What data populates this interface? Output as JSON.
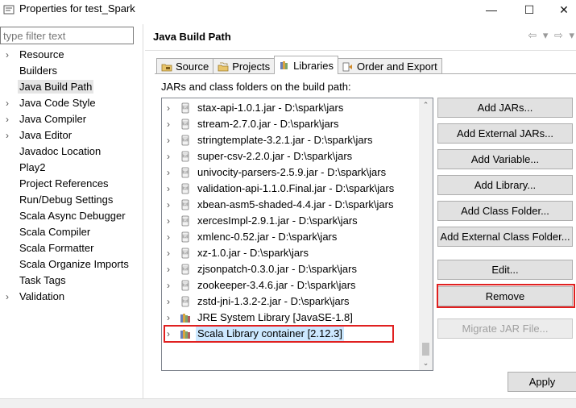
{
  "window": {
    "title": "Properties for test_Spark",
    "minimize_glyph": "—",
    "maximize_glyph": "☐",
    "close_glyph": "✕"
  },
  "filter": {
    "placeholder": "type filter text",
    "value": ""
  },
  "nav": {
    "items": [
      {
        "label": "Resource",
        "expandable": true
      },
      {
        "label": "Builders",
        "expandable": false
      },
      {
        "label": "Java Build Path",
        "expandable": false,
        "selected": true
      },
      {
        "label": "Java Code Style",
        "expandable": true
      },
      {
        "label": "Java Compiler",
        "expandable": true
      },
      {
        "label": "Java Editor",
        "expandable": true
      },
      {
        "label": "Javadoc Location",
        "expandable": false
      },
      {
        "label": "Play2",
        "expandable": false
      },
      {
        "label": "Project References",
        "expandable": false
      },
      {
        "label": "Run/Debug Settings",
        "expandable": false
      },
      {
        "label": "Scala Async Debugger",
        "expandable": false
      },
      {
        "label": "Scala Compiler",
        "expandable": false
      },
      {
        "label": "Scala Formatter",
        "expandable": false
      },
      {
        "label": "Scala Organize Imports",
        "expandable": false
      },
      {
        "label": "Task Tags",
        "expandable": false
      },
      {
        "label": "Validation",
        "expandable": true
      }
    ]
  },
  "page": {
    "title": "Java Build Path",
    "nav_arrows": "⇦ ▾ ⇨ ▾"
  },
  "tabs": [
    {
      "label": "Source",
      "icon": "source-folder-icon"
    },
    {
      "label": "Projects",
      "icon": "projects-icon"
    },
    {
      "label": "Libraries",
      "icon": "libraries-icon",
      "active": true
    },
    {
      "label": "Order and Export",
      "icon": "order-export-icon"
    }
  ],
  "libraries": {
    "label": "JARs and class folders on the build path:",
    "rows": [
      {
        "label": "stax-api-1.0.1.jar - D:\\spark\\jars",
        "icon": "jar-icon"
      },
      {
        "label": "stream-2.7.0.jar - D:\\spark\\jars",
        "icon": "jar-icon"
      },
      {
        "label": "stringtemplate-3.2.1.jar - D:\\spark\\jars",
        "icon": "jar-icon"
      },
      {
        "label": "super-csv-2.2.0.jar - D:\\spark\\jars",
        "icon": "jar-icon"
      },
      {
        "label": "univocity-parsers-2.5.9.jar - D:\\spark\\jars",
        "icon": "jar-icon"
      },
      {
        "label": "validation-api-1.1.0.Final.jar - D:\\spark\\jars",
        "icon": "jar-icon"
      },
      {
        "label": "xbean-asm5-shaded-4.4.jar - D:\\spark\\jars",
        "icon": "jar-icon"
      },
      {
        "label": "xercesImpl-2.9.1.jar - D:\\spark\\jars",
        "icon": "jar-icon"
      },
      {
        "label": "xmlenc-0.52.jar - D:\\spark\\jars",
        "icon": "jar-icon"
      },
      {
        "label": "xz-1.0.jar - D:\\spark\\jars",
        "icon": "jar-icon"
      },
      {
        "label": "zjsonpatch-0.3.0.jar - D:\\spark\\jars",
        "icon": "jar-icon"
      },
      {
        "label": "zookeeper-3.4.6.jar - D:\\spark\\jars",
        "icon": "jar-icon"
      },
      {
        "label": "zstd-jni-1.3.2-2.jar - D:\\spark\\jars",
        "icon": "jar-icon"
      },
      {
        "label": "JRE System Library [JavaSE-1.8]",
        "icon": "library-icon"
      },
      {
        "label": "Scala Library container [2.12.3]",
        "icon": "library-icon",
        "selected": true
      }
    ]
  },
  "buttons": {
    "add_jars": "Add JARs...",
    "add_external_jars": "Add External JARs...",
    "add_variable": "Add Variable...",
    "add_library": "Add Library...",
    "add_class_folder": "Add Class Folder...",
    "add_external_class_folder": "Add External Class Folder...",
    "edit": "Edit...",
    "remove": "Remove",
    "migrate_jar": "Migrate JAR File...",
    "apply": "Apply"
  },
  "colors": {
    "highlight_red": "#e02020",
    "selection_blue": "#cce8ff"
  }
}
